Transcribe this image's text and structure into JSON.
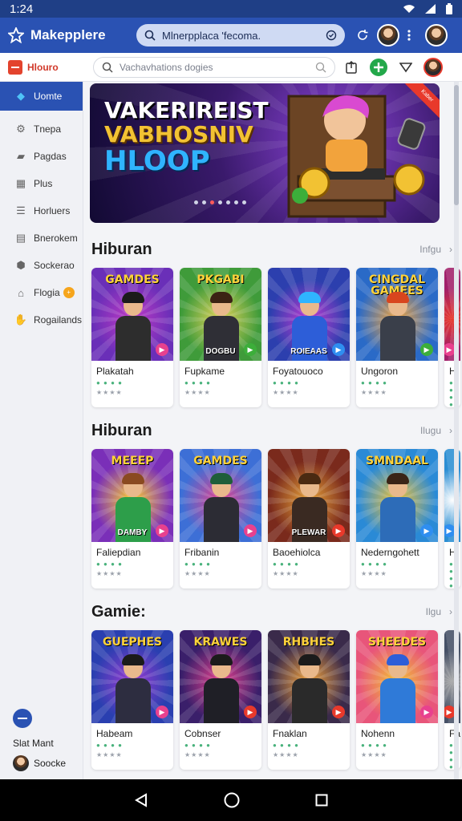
{
  "status": {
    "time": "1:24"
  },
  "appbar": {
    "title": "Makepplere",
    "url": "Mlnerpplaca 'fecoma."
  },
  "subbar": {
    "menu_label": "Hlouro",
    "search_placeholder": "Vachavhations dogies"
  },
  "sidebar": {
    "items": [
      {
        "label": "Uomte",
        "icon": "cube-icon",
        "active": true
      },
      {
        "label": "Tnepa",
        "icon": "gear-icon",
        "active": false
      },
      {
        "label": "Pagdas",
        "icon": "folder-icon",
        "active": false
      },
      {
        "label": "Plus",
        "icon": "grid-icon",
        "active": false
      },
      {
        "label": "Horluers",
        "icon": "list-icon",
        "active": false
      },
      {
        "label": "Bnerokem",
        "icon": "document-icon",
        "active": false
      },
      {
        "label": "Sockerao",
        "icon": "shield-icon",
        "active": false
      },
      {
        "label": "Flogia",
        "icon": "home-icon",
        "active": false,
        "badge": "+"
      },
      {
        "label": "Rogailands",
        "icon": "handshake-icon",
        "active": false
      }
    ],
    "status_label": "Slat Mant",
    "user_label": "Soocke"
  },
  "hero": {
    "line1": "VAKERIREIST",
    "line2": "VABHOSNIV",
    "line3": "HLOOP",
    "ribbon": "Kaber",
    "slides": 7,
    "active_slide": 2
  },
  "sections": [
    {
      "title": "Hiburan",
      "more": "Infgu",
      "cards": [
        {
          "name": "Plakatah",
          "art_title": "GAMDES",
          "art_sub": "",
          "bg": "#6a2fb8",
          "accent": "#c03ac4",
          "hair": "#1b1b1b",
          "shirt": "#2d2d2d",
          "badge_color": "#e8418e"
        },
        {
          "name": "Fupkame",
          "art_title": "PKGABI",
          "art_sub": "DOGBU",
          "bg": "#3f9b3a",
          "accent": "#e3d35a",
          "hair": "#3b2314",
          "shirt": "#2f2f36",
          "badge_color": "#3cae3a"
        },
        {
          "name": "Foyatouoco",
          "art_title": "",
          "art_sub": "ROIEAAS",
          "bg": "#2c3fae",
          "accent": "#c03ad1",
          "hair": "#2fb4ff",
          "shirt": "#2d5ed8",
          "badge_color": "#2f8ef0"
        },
        {
          "name": "Ungoron",
          "art_title": "CINGDAL GAMEES",
          "art_sub": "",
          "bg": "#2a6ac7",
          "accent": "#f2a33c",
          "hair": "#d8451e",
          "shirt": "#3a3f4a",
          "badge_color": "#3cae3a"
        },
        {
          "name": "Hi",
          "art_title": "",
          "art_sub": "",
          "bg": "#a11f6a",
          "accent": "#e8392b",
          "hair": "#222",
          "shirt": "#333",
          "badge_color": "#e8418e"
        }
      ]
    },
    {
      "title": "Hiburan",
      "more": "Ilugu",
      "cards": [
        {
          "name": "Faliepdian",
          "art_title": "MEEEP",
          "art_sub": "DAMBY",
          "bg": "#7a2fb8",
          "accent": "#ffcf2e",
          "hair": "#8a4a20",
          "shirt": "#2d9e4a",
          "badge_color": "#e8418e"
        },
        {
          "name": "Fribanin",
          "art_title": "GAMDES",
          "art_sub": "",
          "bg": "#3d6fd6",
          "accent": "#e8418e",
          "hair": "#1f5e3a",
          "shirt": "#2c2c34",
          "badge_color": "#e8418e"
        },
        {
          "name": "Baoehiolca",
          "art_title": "",
          "art_sub": "PLEWAR",
          "bg": "#7a2a1c",
          "accent": "#e6a23a",
          "hair": "#4a2a12",
          "shirt": "#3a2a22",
          "badge_color": "#e8392b"
        },
        {
          "name": "Nederngohett",
          "art_title": "SMNDAAL",
          "art_sub": "",
          "bg": "#2a8ad6",
          "accent": "#f2c233",
          "hair": "#3a2416",
          "shirt": "#2d6cb8",
          "badge_color": "#2f8ef0"
        },
        {
          "name": "Hi",
          "art_title": "",
          "art_sub": "",
          "bg": "#2b8ed3",
          "accent": "#fff",
          "hair": "#222",
          "shirt": "#333",
          "badge_color": "#2f8ef0"
        }
      ]
    },
    {
      "title": "Gamie:",
      "more": "Ilgu",
      "cards": [
        {
          "name": "Habeam",
          "art_title": "GUEPHES",
          "art_sub": "",
          "bg": "#2a3fb0",
          "accent": "#9b3ad1",
          "hair": "#1b1b1b",
          "shirt": "#2d2d40",
          "badge_color": "#e8418e"
        },
        {
          "name": "Cobnser",
          "art_title": "KRAWES",
          "art_sub": "",
          "bg": "#3a1f6a",
          "accent": "#e8418e",
          "hair": "#1b1b1b",
          "shirt": "#1f1f26",
          "badge_color": "#e8392b"
        },
        {
          "name": "Fnaklan",
          "art_title": "RHBHES",
          "art_sub": "",
          "bg": "#3a2a4a",
          "accent": "#f2a33c",
          "hair": "#1b1b1b",
          "shirt": "#2a2a2a",
          "badge_color": "#e8392b"
        },
        {
          "name": "Nohenn",
          "art_title": "SHEEDES",
          "art_sub": "",
          "bg": "#e8557a",
          "accent": "#f2c233",
          "hair": "#2d5ed8",
          "shirt": "#2f7ad8",
          "badge_color": "#e8418e"
        },
        {
          "name": "Fa",
          "art_title": "",
          "art_sub": "",
          "bg": "#455066",
          "accent": "#aaa",
          "hair": "#222",
          "shirt": "#333",
          "badge_color": "#e8392b"
        }
      ]
    }
  ]
}
